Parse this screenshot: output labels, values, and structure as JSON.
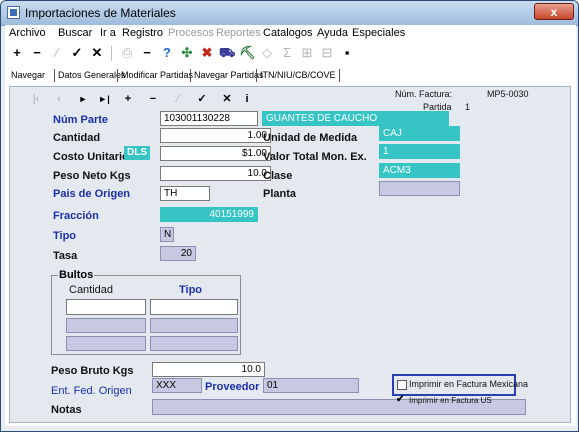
{
  "window": {
    "title": "Importaciones de Materiales",
    "close": "x"
  },
  "menu": [
    {
      "label": "Archivo",
      "enabled": true
    },
    {
      "label": "Buscar",
      "enabled": true
    },
    {
      "label": "Ir a",
      "enabled": true
    },
    {
      "label": "Registro",
      "enabled": true
    },
    {
      "label": "Procesos",
      "enabled": false
    },
    {
      "label": "Reportes",
      "enabled": false
    },
    {
      "label": "Catalogos",
      "enabled": true
    },
    {
      "label": "Ayuda",
      "enabled": true
    },
    {
      "label": "Especiales",
      "enabled": true
    }
  ],
  "toolbar": {
    "add": "+",
    "remove": "−",
    "dim1": "⁄",
    "accept": "✓",
    "cancel": "✕",
    "print": "⎙",
    "minus": "−",
    "help": "?",
    "tool1": "✣",
    "tool2": "✖",
    "tool3": "⛟",
    "tool4": "⛏",
    "tool5": "◇",
    "sum": "Σ",
    "tool6": "⊞",
    "tool7": "⊟",
    "save": "▪"
  },
  "tabs": [
    "Navegar",
    "Datos Generales",
    "Modificar Partidas",
    "Navegar Partidas",
    "ITN/NIU/CB/COVE"
  ],
  "nav": {
    "first": "|‹",
    "prev": "‹",
    "next": "►",
    "last": "►|",
    "add": "+",
    "remove": "−",
    "dim": "⁄",
    "accept": "✓",
    "cancel": "✕",
    "info": "i"
  },
  "header": {
    "num_factura_label": "Núm. Factura:",
    "num_factura": "MP5-0030",
    "partida_label": "Partida",
    "partida": "1"
  },
  "form": {
    "num_parte_label": "Núm Parte",
    "num_parte": "103001130228",
    "descripcion": "GUANTES DE CAUCHO",
    "cantidad_label": "Cantidad",
    "cantidad": "1.00",
    "unidad_label": "Unidad de Medida",
    "unidad": "CAJ",
    "costo_label": "Costo Unitario",
    "moneda": "DLS",
    "costo": "$1.00",
    "valor_label": "Valor Total Mon. Ex.",
    "valor": "1",
    "peso_neto_label": "Peso Neto Kgs",
    "peso_neto": "10.0",
    "clase_label": "Clase",
    "clase": "ACM3",
    "pais_label": "Pais de Origen",
    "pais": "TH",
    "planta_label": "Planta",
    "planta": "",
    "fraccion_label": "Fracción",
    "fraccion": "40151999",
    "tipo_label": "Tipo",
    "tipo": "N",
    "tasa_label": "Tasa",
    "tasa": "20",
    "bultos_label": "Bultos",
    "bultos_cantidad_label": "Cantidad",
    "bultos_tipo_label": "Tipo",
    "peso_bruto_label": "Peso Bruto Kgs",
    "peso_bruto": "10.0",
    "ent_fed_label": "Ent. Fed. Origen",
    "ent_fed": "XXX",
    "proveedor_label": "Proveedor",
    "proveedor": "01",
    "notas_label": "Notas",
    "notas": "",
    "imprimir_mx_label": "Imprimir en Factura Mexicana",
    "imprimir_mx_checked": false,
    "imprimir_us_label": "Imprimir en Factura US",
    "imprimir_us_checked": true
  },
  "colors": {
    "teal": "#36c4c4",
    "label_blue": "#1b2fa8",
    "gray_field": "#c6c9e1",
    "focus": "#2b3fb0"
  }
}
